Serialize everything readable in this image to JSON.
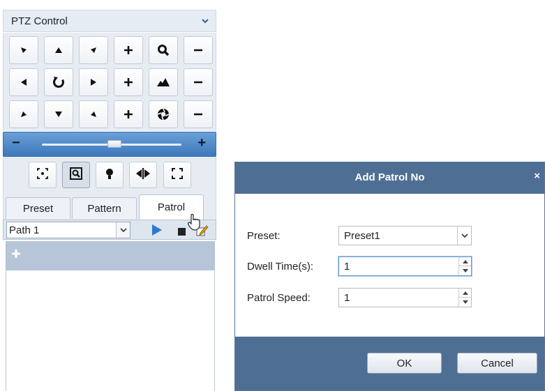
{
  "ptz": {
    "title": "PTZ Control",
    "tabs": [
      "Preset",
      "Pattern",
      "Patrol"
    ],
    "active_tab": "Patrol",
    "path_value": "Path 1",
    "slider_minus": "−",
    "slider_plus": "+",
    "slider_level_percent": 52,
    "add_label": "+",
    "grid_buttons": [
      [
        "arrow-up-left-icon",
        "arrow-up-icon",
        "arrow-up-right-icon",
        "zoom-in-icon",
        "zoom-icon",
        "zoom-out-icon"
      ],
      [
        "arrow-left-icon",
        "auto-scan-icon",
        "arrow-right-icon",
        "focus-in-icon",
        "focus-icon",
        "focus-out-icon"
      ],
      [
        "arrow-down-left-icon",
        "arrow-down-icon",
        "arrow-down-right-icon",
        "iris-open-icon",
        "iris-icon",
        "iris-close-icon"
      ]
    ],
    "tool_buttons": [
      "3d-positioning-icon",
      "manual-tracking-icon",
      "light-icon",
      "wiper-icon",
      "one-touch-focus-icon"
    ]
  },
  "dialog": {
    "title": "Add Patrol No",
    "close": "×",
    "preset_label": "Preset:",
    "preset_value": "Preset1",
    "dwell_label": "Dwell Time(s):",
    "dwell_value": "1",
    "speed_label": "Patrol Speed:",
    "speed_value": "1",
    "ok": "OK",
    "cancel": "Cancel"
  },
  "colors": {
    "dialog_header": "#4f6e94",
    "slider_bar": "#4a86c8",
    "play_icon": "#2a7bd0",
    "selected_row": "#b7c5d8"
  }
}
